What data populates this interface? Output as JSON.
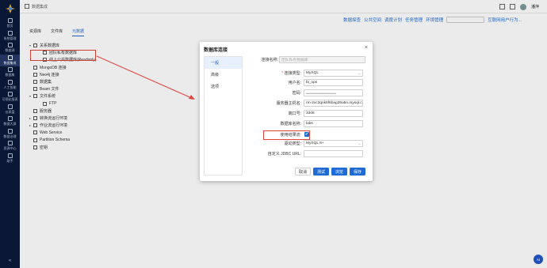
{
  "nav": {
    "items": [
      {
        "label": "首页",
        "icon": "home-icon"
      },
      {
        "label": "系统管理",
        "icon": "settings-icon"
      },
      {
        "label": "数据源",
        "icon": "database-icon"
      },
      {
        "label": "数据集成",
        "icon": "integration-icon",
        "active": true
      },
      {
        "label": "数据集",
        "icon": "dataset-icon"
      },
      {
        "label": "人工智能",
        "icon": "ai-icon"
      },
      {
        "label": "可视化报表",
        "icon": "report-icon"
      },
      {
        "label": "仪表盘",
        "icon": "dashboard-icon"
      },
      {
        "label": "数据大屏",
        "icon": "screen-icon"
      },
      {
        "label": "数据治理",
        "icon": "governance-icon"
      },
      {
        "label": "资源中心",
        "icon": "resource-icon"
      },
      {
        "label": "助手",
        "icon": "assistant-icon"
      }
    ],
    "collapse": "«"
  },
  "topbar": {
    "breadcrumb": "数据集成",
    "username": "潘萍"
  },
  "toolbar2": {
    "links": [
      "数据探查",
      "公共空间",
      "调度计划",
      "任务管理",
      "环境管理"
    ],
    "behavior": "互联网用户行为..."
  },
  "tabs": [
    {
      "label": "资源库",
      "active": false
    },
    {
      "label": "文件库",
      "active": false
    },
    {
      "label": "元数据",
      "active": true
    }
  ],
  "tree": [
    {
      "label": "关系数据库",
      "level": 0,
      "arrow": "▾"
    },
    {
      "label": "团队私有数据库",
      "level": 1,
      "arrow": ""
    },
    {
      "label": "线上公共数据库(Readonly)",
      "level": 1,
      "arrow": ""
    },
    {
      "label": "MongoDB 连接",
      "level": 0,
      "arrow": ""
    },
    {
      "label": "Neo4j 连接",
      "level": 0,
      "arrow": ""
    },
    {
      "label": "数据集",
      "level": 0,
      "arrow": ""
    },
    {
      "label": "Beam 文件",
      "level": 0,
      "arrow": ""
    },
    {
      "label": "文件系统",
      "level": 0,
      "arrow": "▾"
    },
    {
      "label": "FTP",
      "level": 1,
      "arrow": ""
    },
    {
      "label": "服务器",
      "level": 0,
      "arrow": ""
    },
    {
      "label": "转换流运行环境",
      "level": 0,
      "arrow": "▸"
    },
    {
      "label": "作业流运行环境",
      "level": 0,
      "arrow": "▸"
    },
    {
      "label": "Web Service",
      "level": 0,
      "arrow": ""
    },
    {
      "label": "Partition Schema",
      "level": 0,
      "arrow": ""
    },
    {
      "label": "密钥",
      "level": 0,
      "arrow": ""
    }
  ],
  "dialog": {
    "title": "数据库连接",
    "close": "×",
    "side": [
      {
        "label": "一般",
        "active": true
      },
      {
        "label": "高级",
        "active": false
      },
      {
        "label": "选项",
        "active": false
      }
    ],
    "fields": {
      "conn_name": {
        "label": "连接名称:",
        "placeholder": "团队私有数据库"
      },
      "conn_type": {
        "label": "连接类型:",
        "value": "MySQL"
      },
      "username": {
        "label": "用户名:",
        "value": "bi_ops"
      },
      "password": {
        "label": "密码:",
        "value": "••••••••••••••••••••••••••••••••••••"
      },
      "host": {
        "label": "服务器主机名:",
        "value": "rm-2vc3qnk6f6bag39a5n.mysql.c"
      },
      "port": {
        "label": "端口号:",
        "value": "3306"
      },
      "dbname": {
        "label": "数据库名称:",
        "value": "labs"
      },
      "use_cluster": {
        "label": "使用结果流:",
        "checked": "✔"
      },
      "driver": {
        "label": "驱动类型:",
        "value": "MySQL 8+"
      },
      "jdbc_url": {
        "label": "自定义 JDBC URL:",
        "value": ""
      }
    },
    "buttons": {
      "cancel": "取消",
      "test": "测试",
      "browse": "浏览",
      "save": "保存"
    }
  },
  "ai_badge": "AI"
}
